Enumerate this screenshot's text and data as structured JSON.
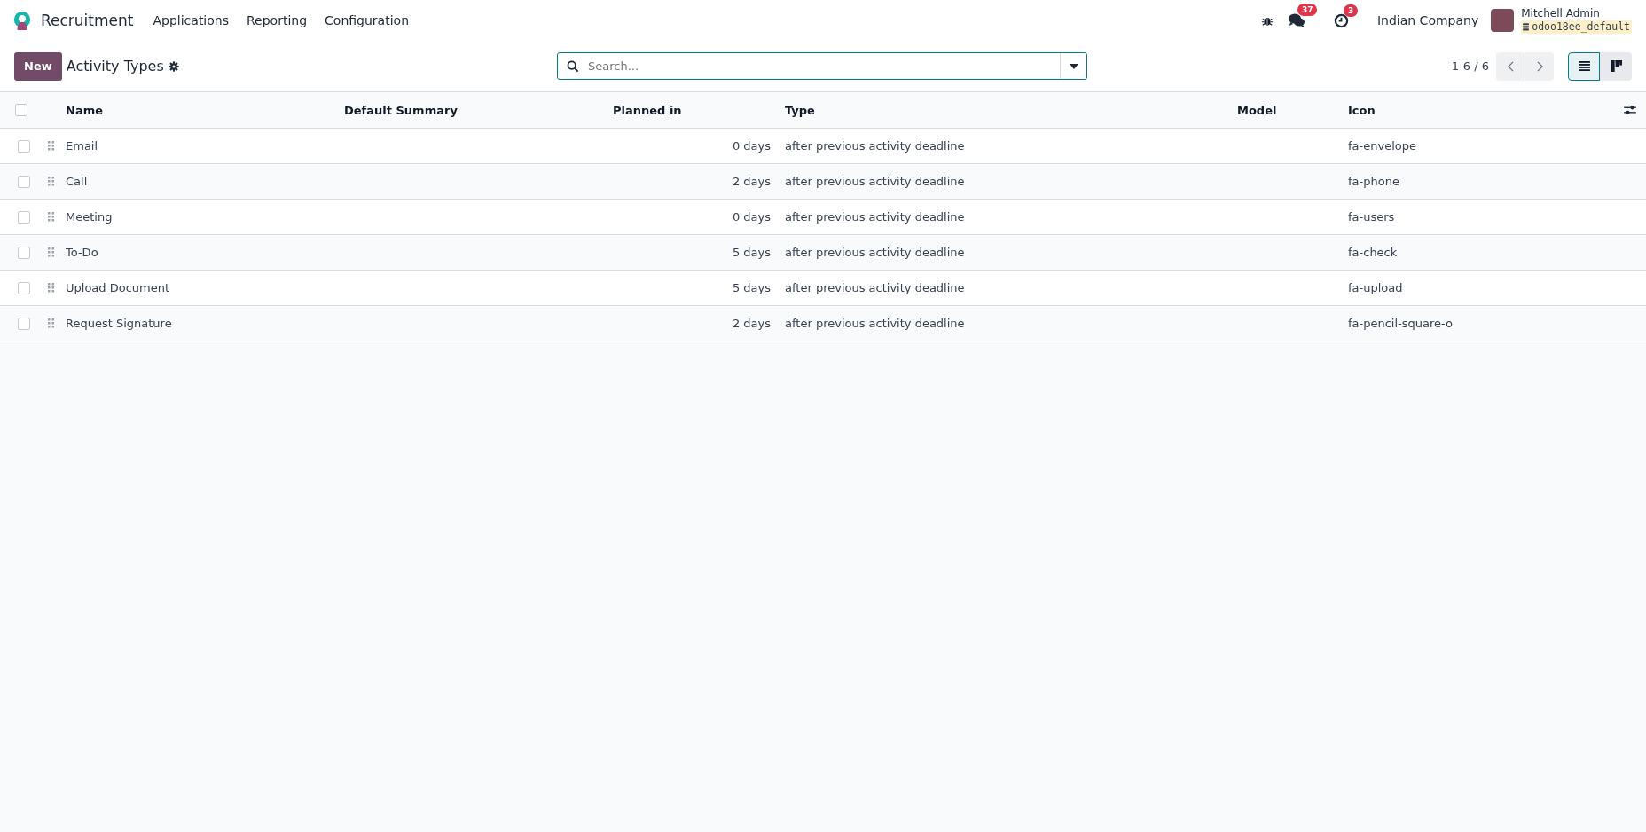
{
  "navbar": {
    "app_name": "Recruitment",
    "menu": [
      "Applications",
      "Reporting",
      "Configuration"
    ],
    "messages_badge": "37",
    "activities_badge": "3",
    "company": "Indian Company",
    "user": {
      "name": "Mitchell Admin",
      "database": "odoo18ee_default"
    }
  },
  "control_panel": {
    "new_button": "New",
    "title": "Activity Types",
    "search": {
      "placeholder": "Search..."
    },
    "pager": "1-6 / 6",
    "views": [
      {
        "kind": "list",
        "selected": true
      },
      {
        "kind": "kanban",
        "selected": false
      }
    ]
  },
  "table": {
    "select_all_checked": false,
    "columns": [
      "Name",
      "Default Summary",
      "Planned in",
      "Type",
      "Model",
      "Icon"
    ],
    "rows": [
      {
        "checked": false,
        "name": "Email",
        "planned": "0 days",
        "type": "after previous activity deadline",
        "icon": "fa-envelope"
      },
      {
        "checked": false,
        "name": "Call",
        "planned": "2 days",
        "type": "after previous activity deadline",
        "icon": "fa-phone"
      },
      {
        "checked": false,
        "name": "Meeting",
        "planned": "0 days",
        "type": "after previous activity deadline",
        "icon": "fa-users"
      },
      {
        "checked": false,
        "name": "To-Do",
        "planned": "5 days",
        "type": "after previous activity deadline",
        "icon": "fa-check"
      },
      {
        "checked": false,
        "name": "Upload Document",
        "planned": "5 days",
        "type": "after previous activity deadline",
        "icon": "fa-upload"
      },
      {
        "checked": false,
        "name": "Request Signature",
        "planned": "2 days",
        "type": "after previous activity deadline",
        "icon": "fa-pencil-square-o"
      }
    ]
  }
}
